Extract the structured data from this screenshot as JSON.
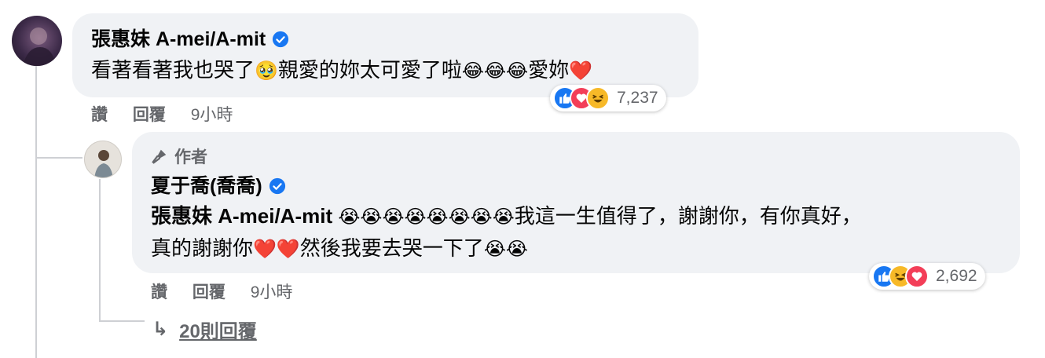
{
  "comment1": {
    "author": "張惠妹 A-mei/A-mit",
    "verified": true,
    "text_parts": [
      "看著看著我也哭了",
      "🥹",
      "親愛的妳太可愛了啦",
      "😂",
      "😂",
      "😂",
      "愛妳",
      "❤️"
    ],
    "actions": {
      "like": "讚",
      "reply": "回覆",
      "time": "9小時"
    },
    "reactions": {
      "icons": [
        "like-icon",
        "love-icon",
        "haha-icon"
      ],
      "count": "7,237"
    }
  },
  "comment2": {
    "author_badge": "作者",
    "author": "夏于喬(喬喬)",
    "verified": true,
    "mention": "張惠妹 A-mei/A-mit",
    "line1_emojis": [
      "😭",
      "😭",
      "😭",
      "😭",
      "😭",
      "😭",
      "😭",
      "😭"
    ],
    "line1_text": "我這一生值得了，謝謝你，有你真好，",
    "line2_text_a": "真的謝謝你",
    "line2_hearts": [
      "❤️",
      "❤️"
    ],
    "line2_text_b": "然後我要去哭一下了",
    "line2_emojis": [
      "😭",
      "😭"
    ],
    "actions": {
      "like": "讚",
      "reply": "回覆",
      "time": "9小時"
    },
    "reactions": {
      "icons": [
        "like-icon",
        "haha-icon",
        "love-icon"
      ],
      "count": "2,692"
    }
  },
  "replies_link": {
    "arrow": "↳",
    "label": "20則回覆"
  },
  "colors": {
    "bubble": "#f0f2f5",
    "secondary_text": "#65676b",
    "verified_blue": "#1877f2",
    "like_blue": "#1877f2",
    "love_red": "#f33e58",
    "haha_yellow": "#f7b928"
  }
}
